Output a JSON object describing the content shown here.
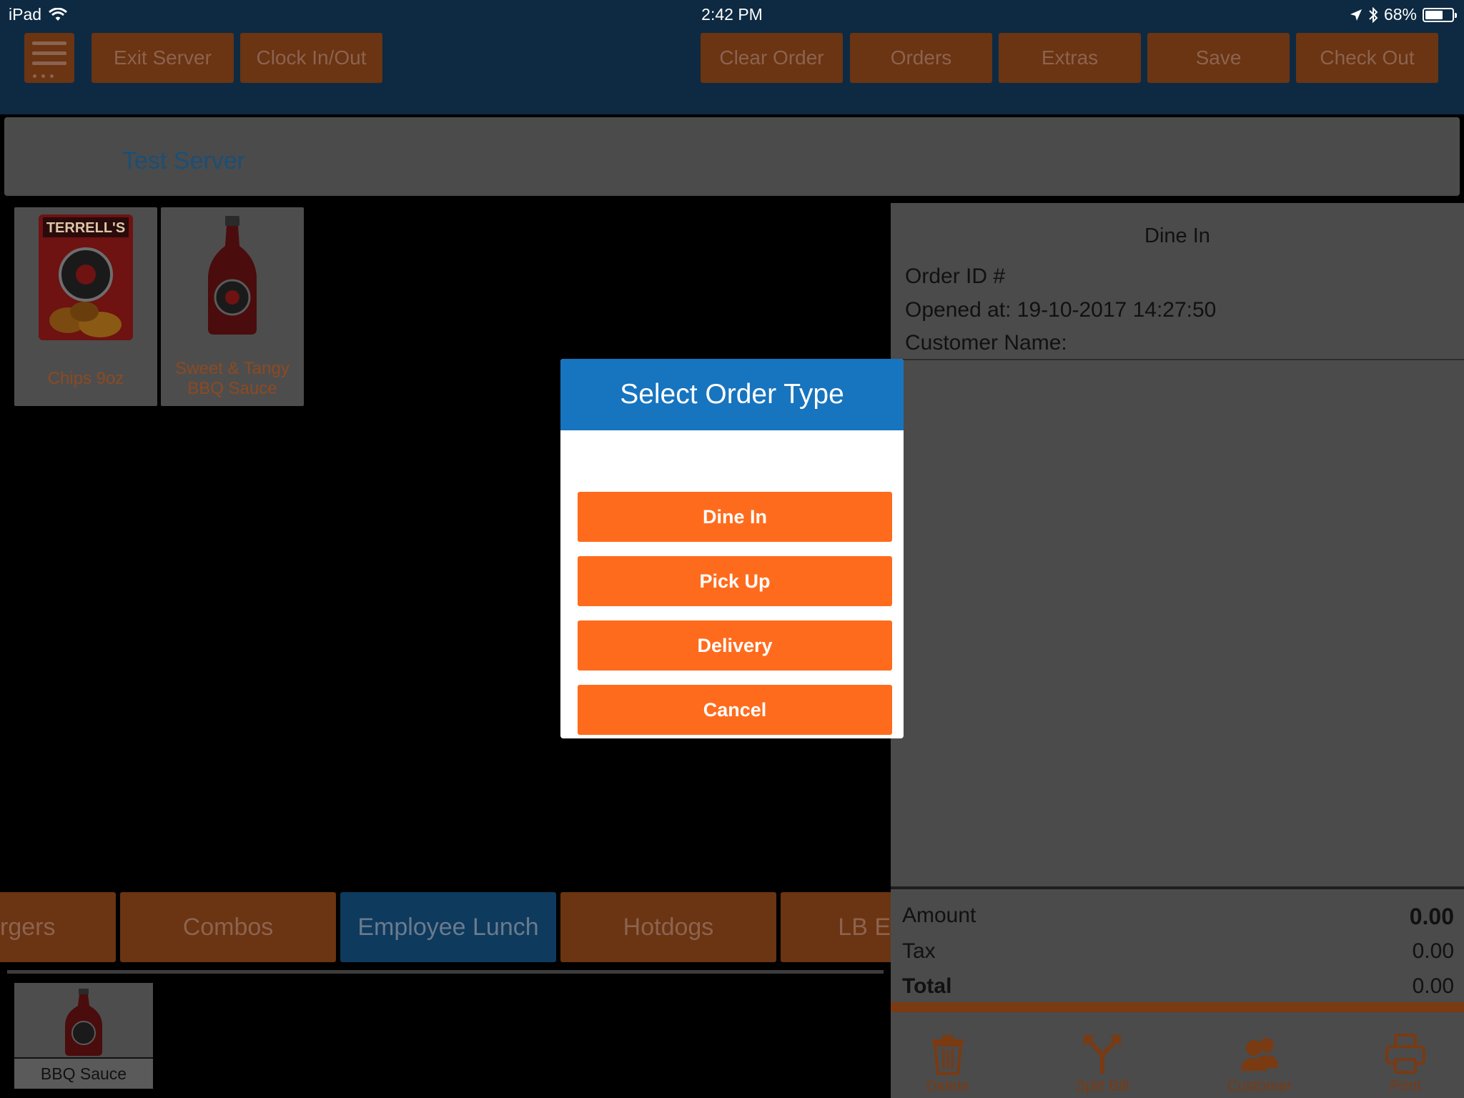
{
  "status_bar": {
    "device": "iPad",
    "time": "2:42 PM",
    "battery": "68%",
    "battery_level": 0.68
  },
  "toolbar": {
    "exit_server": "Exit Server",
    "clock_in_out": "Clock In/Out",
    "clear_order": "Clear Order",
    "orders": "Orders",
    "extras": "Extras",
    "save": "Save",
    "check_out": "Check Out"
  },
  "server": {
    "name": "Test Server"
  },
  "products": [
    {
      "label": "Chips 9oz",
      "image_text": "TERRELL'S"
    },
    {
      "label": "Sweet & Tangy\nBBQ Sauce"
    }
  ],
  "order": {
    "type": "Dine In",
    "order_id": "Order ID #",
    "opened_at": "Opened at: 19-10-2017 14:27:50",
    "customer_name": "Customer Name:",
    "amount_label": "Amount",
    "amount_value": "0.00",
    "tax_label": "Tax",
    "tax_value": "0.00",
    "total_label": "Total",
    "total_value": "0.00"
  },
  "actions": {
    "delete": "Delete",
    "split_bill": "Split Bill",
    "customer": "Customer",
    "print": "Print"
  },
  "categories": [
    {
      "label": "rgers",
      "active": false
    },
    {
      "label": "Combos",
      "active": false
    },
    {
      "label": "Employee Lunch",
      "active": true
    },
    {
      "label": "Hotdogs",
      "active": false
    },
    {
      "label": "LB E",
      "active": false
    }
  ],
  "sub_items": [
    {
      "label": "BBQ Sauce"
    }
  ],
  "dialog": {
    "title": "Select Order Type",
    "dine_in": "Dine In",
    "pick_up": "Pick Up",
    "delivery": "Delivery",
    "cancel": "Cancel"
  },
  "colors": {
    "toolbar_bg": "#0d2a42",
    "dimmed_orange": "#6b3412",
    "accent_orange": "#ff6b1c",
    "dialog_header": "#1774bf"
  }
}
